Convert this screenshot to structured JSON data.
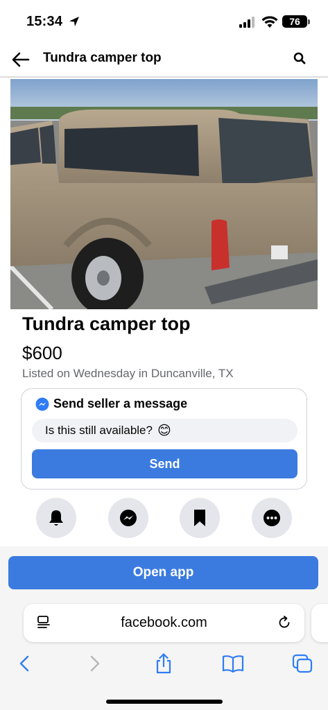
{
  "status_bar": {
    "time": "15:34",
    "battery": "76"
  },
  "header": {
    "title": "Tundra camper top"
  },
  "listing": {
    "title": "Tundra camper top",
    "price": "$600",
    "meta": "Listed on Wednesday in Duncanville, TX"
  },
  "message": {
    "header": "Send seller a message",
    "input_value": "Is this still available?",
    "emoji": "😊",
    "send_label": "Send"
  },
  "actions": [
    {
      "icon": "bell-icon"
    },
    {
      "icon": "messenger-icon"
    },
    {
      "icon": "bookmark-icon"
    },
    {
      "icon": "more-icon"
    }
  ],
  "open_app_label": "Open app",
  "browser": {
    "url": "facebook.com"
  },
  "colors": {
    "accent": "#3b7be0",
    "secondary_text": "#65676b",
    "chip_bg": "#e4e6eb",
    "browser_blue": "#2f7cf6"
  }
}
